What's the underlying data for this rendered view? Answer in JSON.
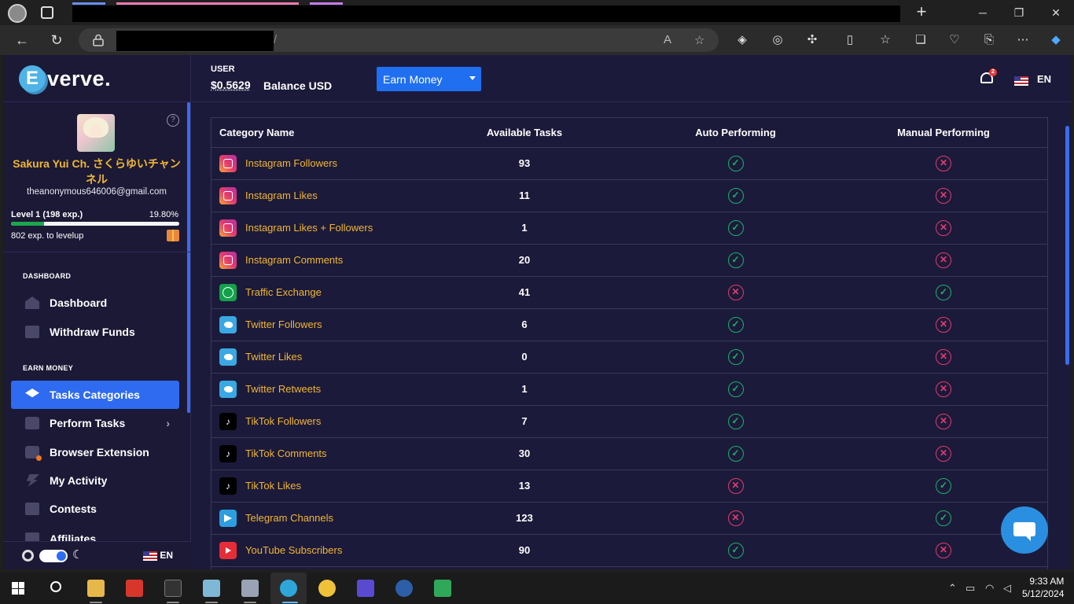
{
  "browser": {
    "tab_new": "+",
    "window_controls": {
      "minimize": "─",
      "maximize": "❐",
      "close": "✕"
    },
    "url_suffix": "/"
  },
  "brand": {
    "logo_letter": "E",
    "logo_text": "verve."
  },
  "profile": {
    "name": "Sakura Yui Ch. さくらゆいチャンネル",
    "email": "theanonymous646006@gmail.com",
    "level_label": "Level 1 (198 exp.)",
    "level_percent_label": "19.80%",
    "level_progress": 19.8,
    "next_level_label": "802 exp. to levelup"
  },
  "sidebar": {
    "section_dashboard": "DASHBOARD",
    "section_earn": "EARN MONEY",
    "items": [
      {
        "label": "Dashboard",
        "icon": "house-icon"
      },
      {
        "label": "Withdraw Funds",
        "icon": "wallet-icon"
      },
      {
        "label": "Tasks Categories",
        "icon": "layers-icon",
        "active": true
      },
      {
        "label": "Perform Tasks",
        "icon": "thumbs-up-icon"
      },
      {
        "label": "Browser Extension",
        "icon": "puzzle-icon"
      },
      {
        "label": "My Activity",
        "icon": "bolt-icon"
      },
      {
        "label": "Contests",
        "icon": "gift-icon"
      },
      {
        "label": "Affiliates",
        "icon": "users-icon"
      }
    ],
    "footer_lang": "EN"
  },
  "header": {
    "user_label": "USER",
    "balance": "$0.5629",
    "balance_currency": "Balance USD",
    "earn_button": "Earn Money",
    "notification_count": "2",
    "lang": "EN"
  },
  "table": {
    "headers": [
      "Category Name",
      "Available Tasks",
      "Auto Performing",
      "Manual Performing"
    ],
    "rows": [
      {
        "icon": "instagram-icon",
        "name": "Instagram Followers",
        "tasks": "93",
        "auto": true,
        "manual": false
      },
      {
        "icon": "instagram-icon",
        "name": "Instagram Likes",
        "tasks": "11",
        "auto": true,
        "manual": false
      },
      {
        "icon": "instagram-icon",
        "name": "Instagram Likes + Followers",
        "tasks": "1",
        "auto": true,
        "manual": false
      },
      {
        "icon": "instagram-icon",
        "name": "Instagram Comments",
        "tasks": "20",
        "auto": true,
        "manual": false
      },
      {
        "icon": "globe-icon",
        "name": "Traffic Exchange",
        "tasks": "41",
        "auto": false,
        "manual": true
      },
      {
        "icon": "twitter-icon",
        "name": "Twitter Followers",
        "tasks": "6",
        "auto": true,
        "manual": false
      },
      {
        "icon": "twitter-icon",
        "name": "Twitter Likes",
        "tasks": "0",
        "auto": true,
        "manual": false
      },
      {
        "icon": "twitter-icon",
        "name": "Twitter Retweets",
        "tasks": "1",
        "auto": true,
        "manual": false
      },
      {
        "icon": "tiktok-icon",
        "name": "TikTok Followers",
        "tasks": "7",
        "auto": true,
        "manual": false
      },
      {
        "icon": "tiktok-icon",
        "name": "TikTok Comments",
        "tasks": "30",
        "auto": true,
        "manual": false
      },
      {
        "icon": "tiktok-icon",
        "name": "TikTok Likes",
        "tasks": "13",
        "auto": false,
        "manual": true
      },
      {
        "icon": "telegram-icon",
        "name": "Telegram Channels",
        "tasks": "123",
        "auto": false,
        "manual": true
      },
      {
        "icon": "youtube-icon",
        "name": "YouTube Subscribers",
        "tasks": "90",
        "auto": true,
        "manual": false
      }
    ]
  },
  "taskbar": {
    "time": "9:33 AM",
    "date": "5/12/2024"
  },
  "colors": {
    "accent": "#2e6bf0",
    "category_text": "#f0b632",
    "yes": "#18b26a",
    "no": "#e23a6e"
  }
}
